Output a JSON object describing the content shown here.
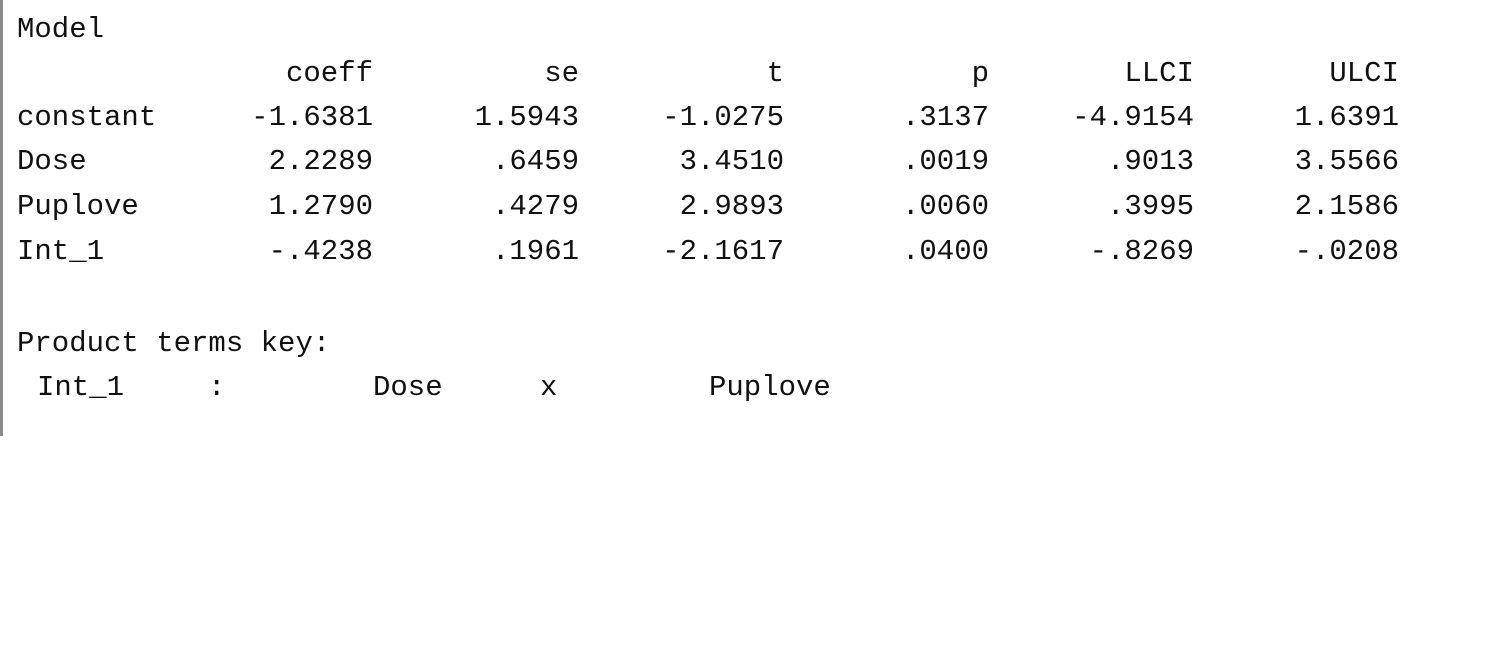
{
  "section_title": "Model",
  "table": {
    "columns": [
      "coeff",
      "se",
      "t",
      "p",
      "LLCI",
      "ULCI"
    ],
    "rows": [
      {
        "label": "constant",
        "values": [
          "-1.6381",
          "1.5943",
          "-1.0275",
          ".3137",
          "-4.9154",
          "1.6391"
        ]
      },
      {
        "label": "Dose",
        "values": [
          "2.2289",
          ".6459",
          "3.4510",
          ".0019",
          ".9013",
          "3.5566"
        ]
      },
      {
        "label": "Puplove",
        "values": [
          "1.2790",
          ".4279",
          "2.9893",
          ".0060",
          ".3995",
          "2.1586"
        ]
      },
      {
        "label": "Int_1",
        "values": [
          "-.4238",
          ".1961",
          "-2.1617",
          ".0400",
          "-.8269",
          "-.0208"
        ]
      }
    ]
  },
  "product_terms": {
    "heading": "Product terms key:",
    "term": "Int_1",
    "separator": ":",
    "var1": "Dose",
    "operator": "x",
    "var2": "Puplove"
  }
}
